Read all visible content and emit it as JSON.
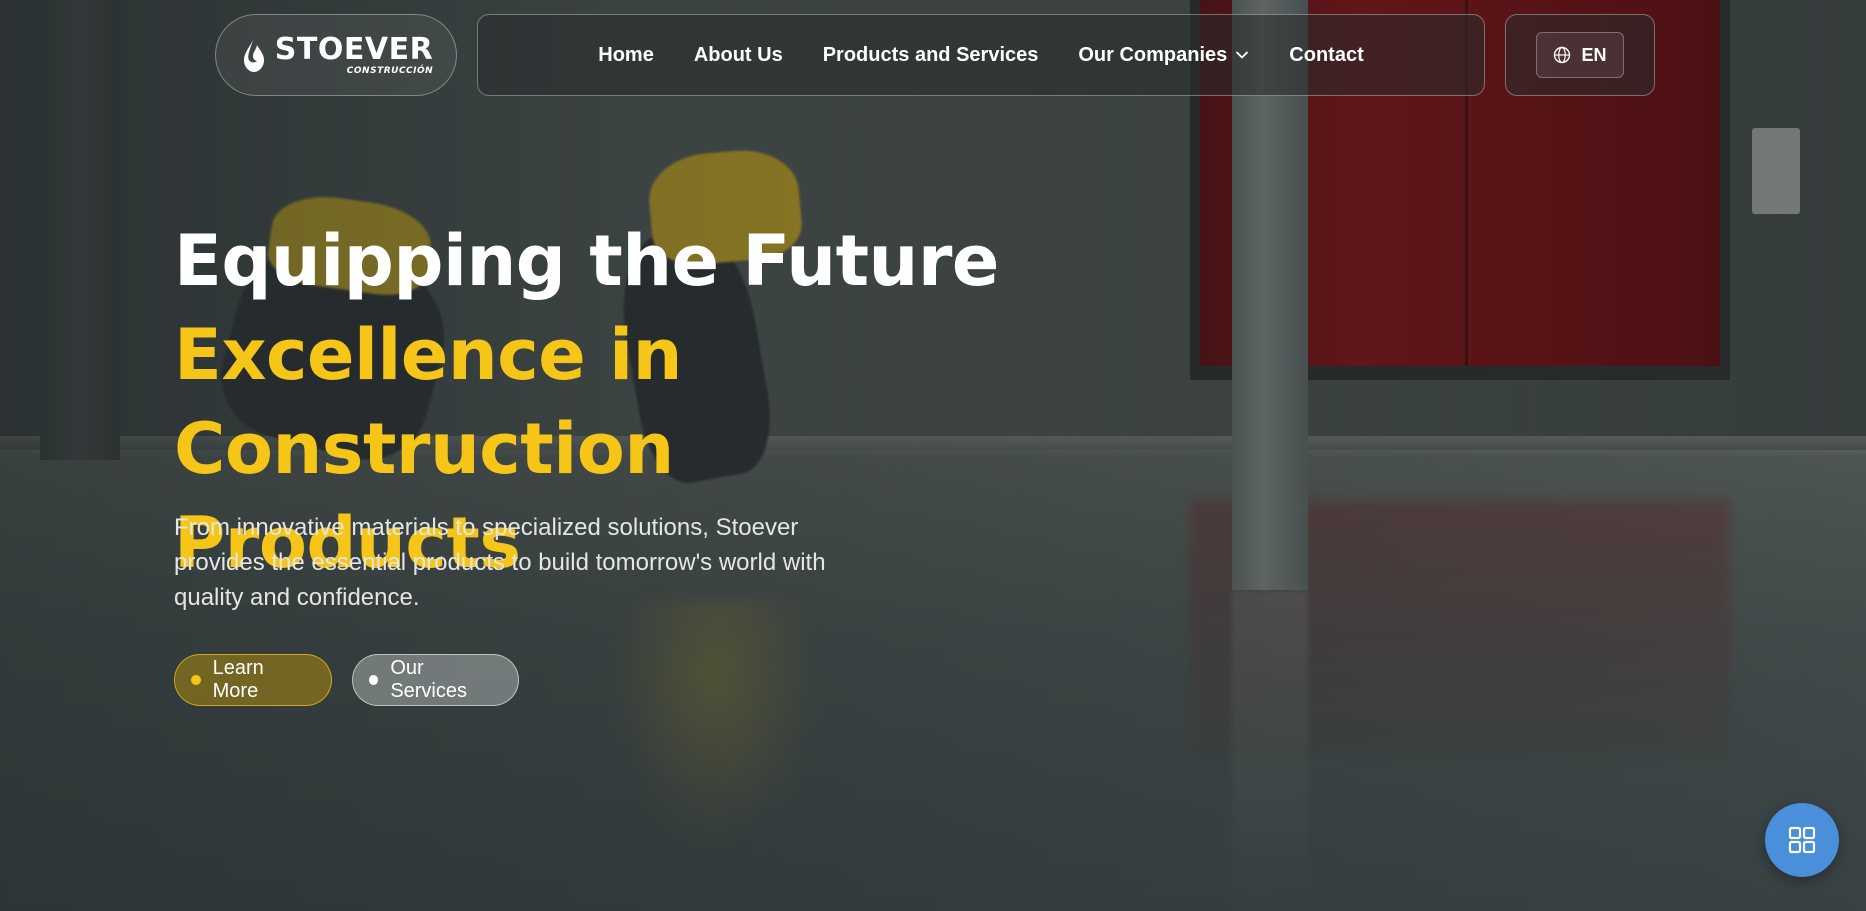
{
  "brand": {
    "name": "STOEVER",
    "subtitle": "CONSTRUCCIÓN",
    "logo_icon": "drop-icon"
  },
  "nav": {
    "items": [
      {
        "label": "Home"
      },
      {
        "label": "About Us"
      },
      {
        "label": "Products and Services"
      },
      {
        "label": "Our Companies",
        "icon": "chevron-down-icon"
      },
      {
        "label": "Contact"
      }
    ]
  },
  "language": {
    "label": "EN",
    "icon": "globe-icon"
  },
  "hero": {
    "title_line1": "Equipping the Future",
    "title_line2": "Excellence in Construction",
    "title_line3": "Products",
    "description": "From innovative materials to specialized solutions, Stoever provides the essential products to build tomorrow's world with quality and confidence.",
    "primary_button": "Learn More",
    "secondary_button": "Our Services"
  },
  "fab": {
    "icon": "grid-icon"
  },
  "colors": {
    "accent": "#f5c518",
    "fab": "#4a8fd9"
  }
}
